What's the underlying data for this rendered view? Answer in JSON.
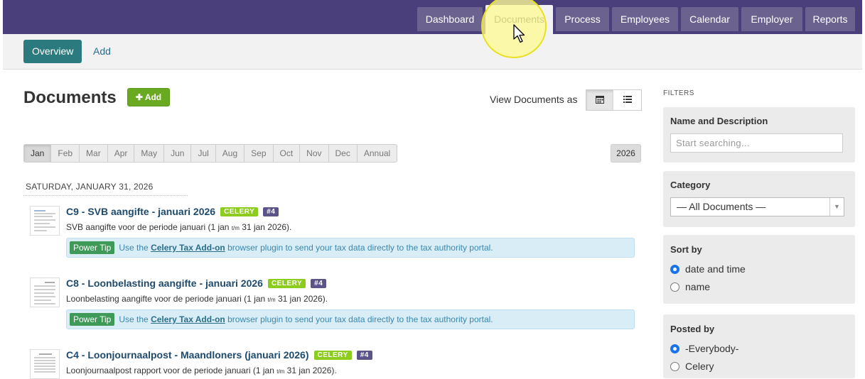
{
  "nav": {
    "tabs": [
      {
        "label": "Dashboard"
      },
      {
        "label": "Documents"
      },
      {
        "label": "Process"
      },
      {
        "label": "Employees"
      },
      {
        "label": "Calendar"
      },
      {
        "label": "Employer"
      },
      {
        "label": "Reports"
      }
    ],
    "active_tab": "Documents"
  },
  "subnav": {
    "overview": "Overview",
    "add": "Add"
  },
  "page": {
    "title": "Documents",
    "add_button": "Add",
    "view_as_label": "View Documents as",
    "view_modes": [
      {
        "icon": "calendar-icon",
        "active": true
      },
      {
        "icon": "list-icon",
        "active": false
      }
    ]
  },
  "months": [
    "Jan",
    "Feb",
    "Mar",
    "Apr",
    "May",
    "Jun",
    "Jul",
    "Aug",
    "Sep",
    "Oct",
    "Nov",
    "Dec",
    "Annual"
  ],
  "selected_month": "Jan",
  "year": "2026",
  "day_label": "SATURDAY, JANUARY 31, 2026",
  "documents": [
    {
      "title": "C9 - SVB aangifte - januari 2026",
      "badge": "CELERY",
      "number": "#4",
      "desc_pre": "SVB aangifte voor de periode januari (1 jan",
      "desc_small": "t/m",
      "desc_post": "31 jan 2026).",
      "tip": {
        "label": "Power Tip",
        "pre": "Use the",
        "link": "Celery Tax Add-on",
        "post": "browser plugin to send your tax data directly to the tax authority portal."
      }
    },
    {
      "title": "C8 - Loonbelasting aangifte - januari 2026",
      "badge": "CELERY",
      "number": "#4",
      "desc_pre": "Loonbelasting aangifte voor de periode januari (1 jan",
      "desc_small": "t/m",
      "desc_post": "31 jan 2026).",
      "tip": {
        "label": "Power Tip",
        "pre": "Use the",
        "link": "Celery Tax Add-on",
        "post": "browser plugin to send your tax data directly to the tax authority portal."
      }
    },
    {
      "title": "C4 - Loonjournaalpost - Maandloners (januari 2026)",
      "badge": "CELERY",
      "number": "#4",
      "desc_pre": "Loonjournaalpost rapport voor de periode januari (1 jan",
      "desc_small": "t/m",
      "desc_post": "31 jan 2026)."
    }
  ],
  "filters": {
    "heading": "FILTERS",
    "name_desc": {
      "label": "Name and Description",
      "placeholder": "Start searching..."
    },
    "category": {
      "label": "Category",
      "selected": "— All Documents —"
    },
    "sort_by": {
      "label": "Sort by",
      "options": [
        "date and time",
        "name"
      ],
      "selected": "date and time"
    },
    "posted_by": {
      "label": "Posted by",
      "options": [
        "-Everybody-",
        "Celery"
      ],
      "selected": "-Everybody-"
    }
  },
  "colors": {
    "topbar": "#4a3f7a",
    "accent": "#2a7a7e",
    "add_green": "#6aaa22",
    "celery_badge": "#8ccc1c",
    "num_badge": "#5a5488",
    "tip_bg": "#d9edf7"
  }
}
